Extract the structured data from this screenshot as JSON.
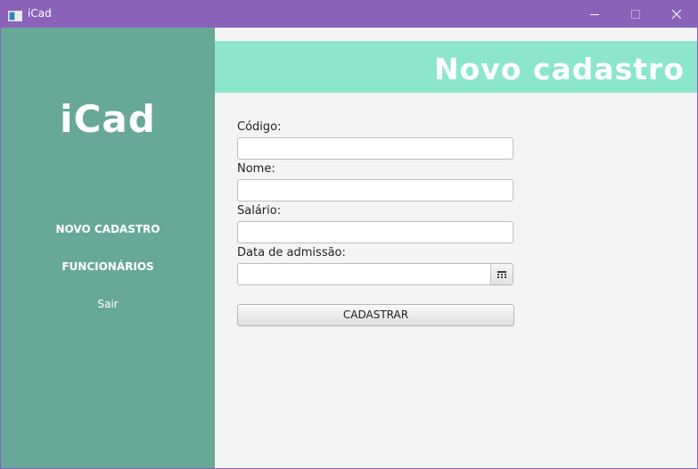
{
  "window": {
    "title": "iCad",
    "app_icon": "window-app-icon",
    "controls": [
      "minimize-icon",
      "maximize-icon",
      "close-icon"
    ],
    "titlebar_color": "#8a62ba"
  },
  "sidebar": {
    "logo": "iCad",
    "background": "#68a898",
    "items": [
      {
        "label": "NOVO CADASTRO"
      },
      {
        "label": "FUNCIONÁRIOS"
      },
      {
        "label": "Sair"
      }
    ]
  },
  "main": {
    "header_title": "Novo cadastro",
    "header_color": "#8be6cb",
    "form": {
      "codigo_label": "Código:",
      "codigo_value": "",
      "nome_label": "Nome:",
      "nome_value": "",
      "salario_label": "Salário:",
      "salario_value": "",
      "data_label": "Data de admissão:",
      "data_value": "",
      "calendar_icon": "calendar-icon",
      "submit_label": "CADASTRAR"
    }
  }
}
